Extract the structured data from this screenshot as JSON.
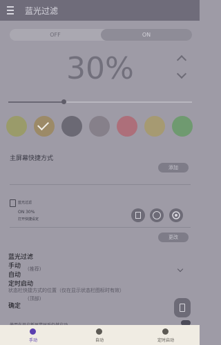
{
  "app": {
    "title": "蓝光过滤"
  },
  "toggle": {
    "off_label": "OFF",
    "on_label": "ON"
  },
  "filter": {
    "intensity_text": "30%",
    "intensity": 0.3
  },
  "colors": {
    "swatches": [
      "#9a9b6a",
      "#9c8a67",
      "#6b6974",
      "#86808a",
      "#ad6f7a",
      "#a69a72",
      "#6f9a70"
    ],
    "selected_index": 1
  },
  "main_shortcut": {
    "label": "主屏幕快捷方式",
    "button_label": "添加"
  },
  "notification": {
    "app_name": "蓝光过滤",
    "status": "ON 30%",
    "detail": "打开快捷设定",
    "button_label": "更改",
    "icons": [
      "phone-icon",
      "screenshot-icon",
      "settings-icon"
    ]
  },
  "overlay_menu": {
    "items": [
      "蓝光过滤",
      "手动",
      "自动",
      "定时启动",
      "确定"
    ]
  },
  "underlying": {
    "left_text": "(推荐)",
    "position_text": "状态栏快捷方式的位置（仅在显示状态栏图标时有效）",
    "position_value": "(顶部)",
    "bottom_strip": "使用在开启新屏幕时后仍然启动"
  },
  "bottom_nav": {
    "items": [
      {
        "label": "手动",
        "icon": "manual-icon",
        "active": true
      },
      {
        "label": "自动",
        "icon": "auto-icon",
        "active": false
      },
      {
        "label": "定时启动",
        "icon": "alarm-clock-icon",
        "active": false
      }
    ],
    "active_color": "#5b3fb0"
  }
}
